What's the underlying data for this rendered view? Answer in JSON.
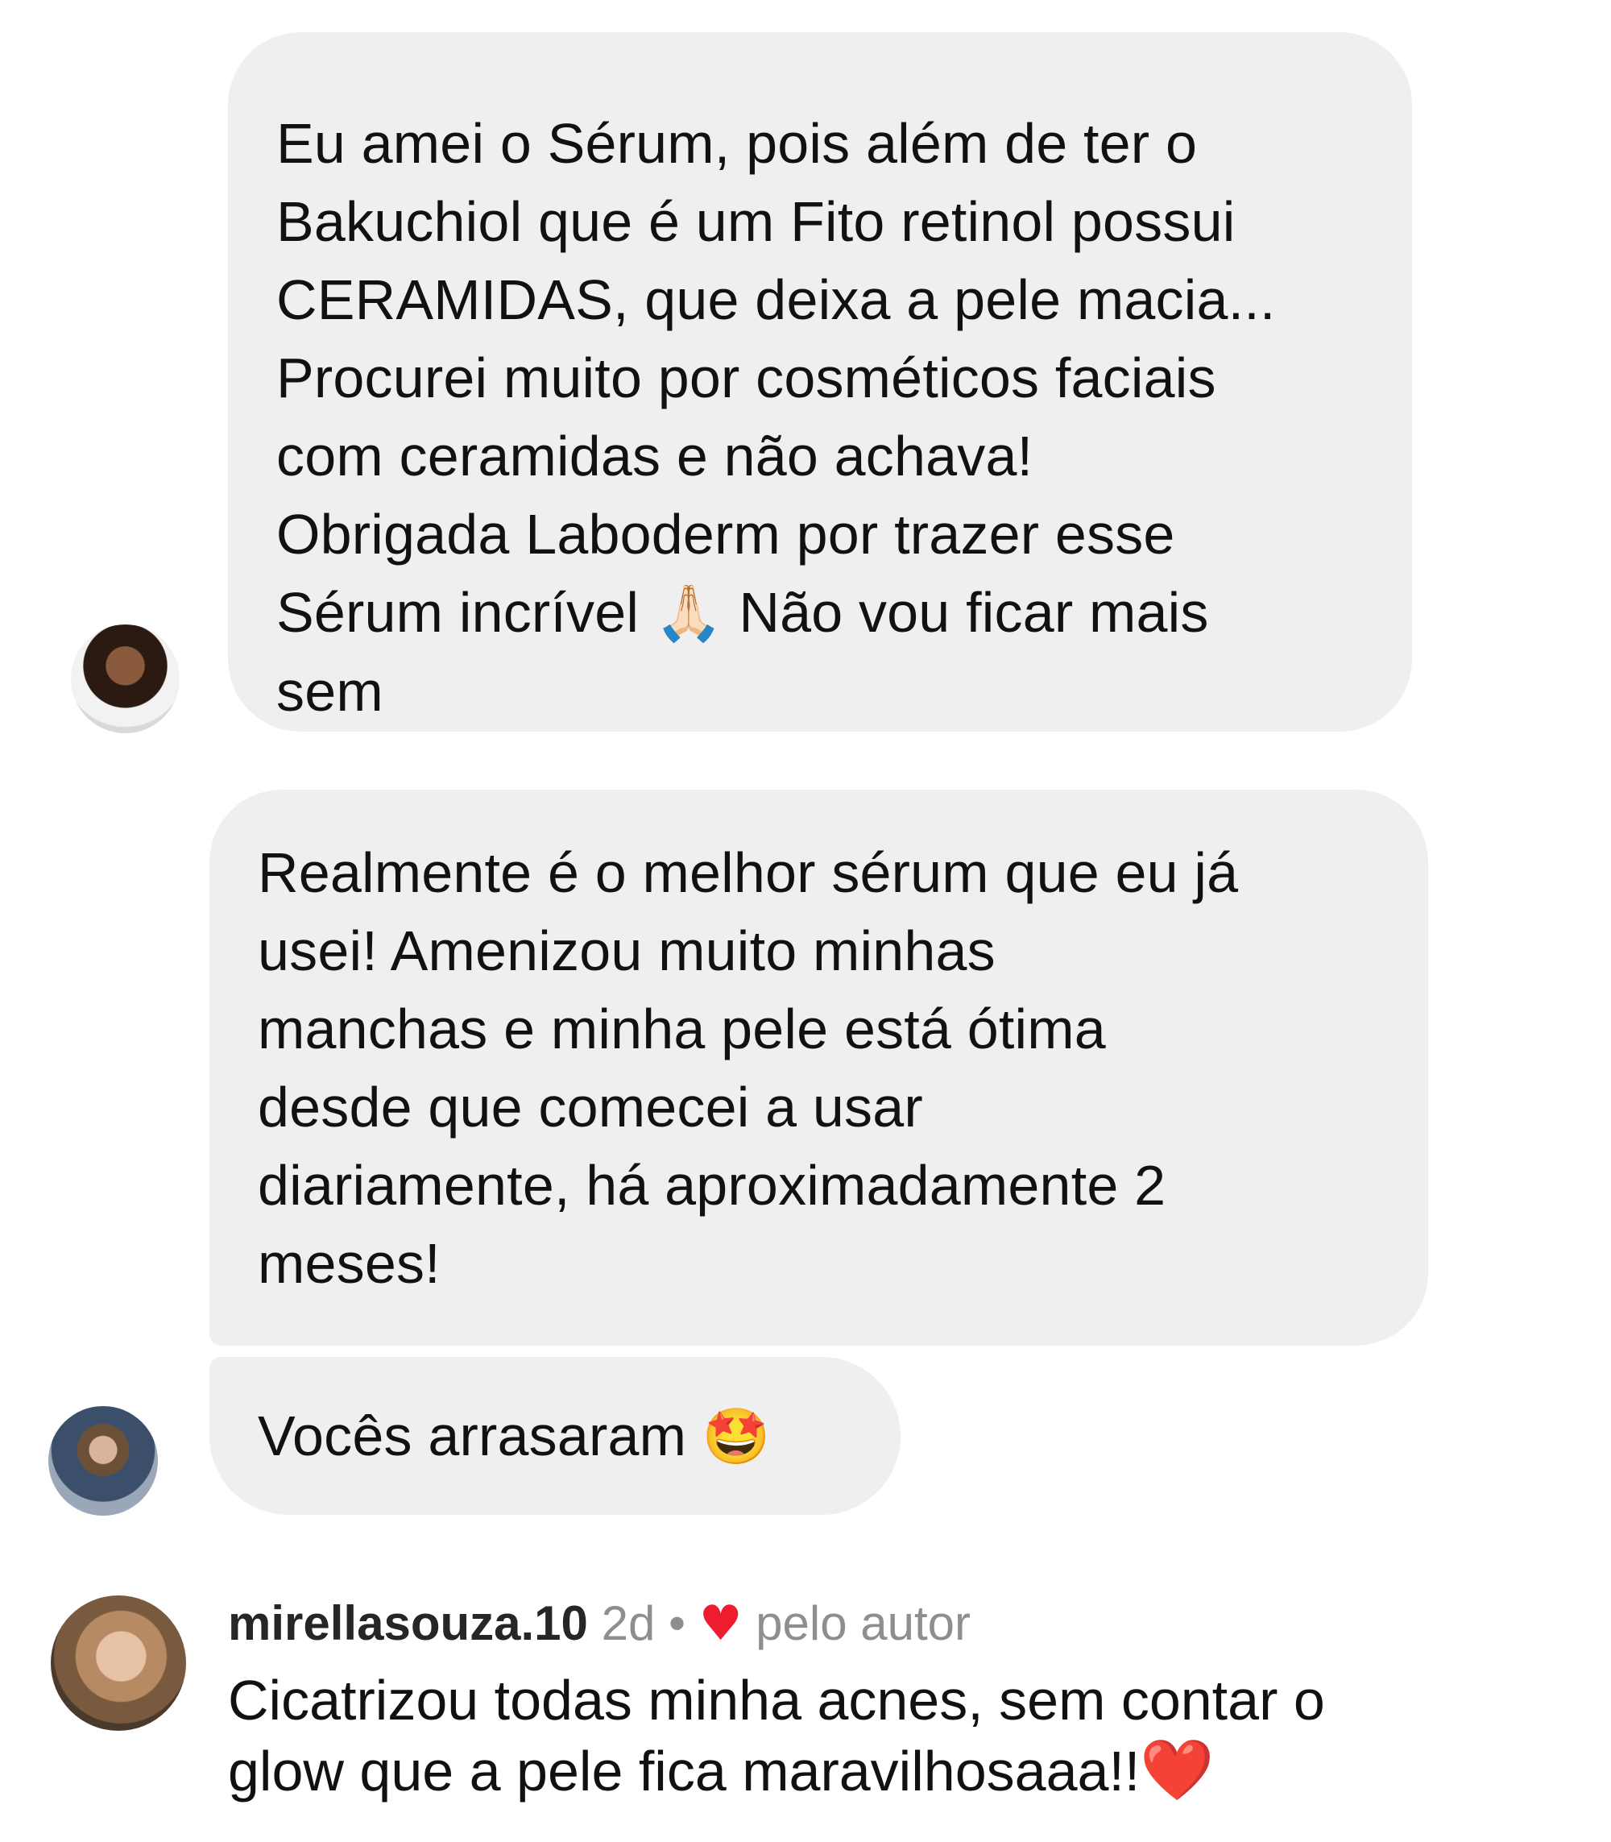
{
  "messages": [
    {
      "lines_before_emoji": "Eu amei o Sérum, pois além de ter o\nBakuchiol que é um Fito retinol possui\nCERAMIDAS, que deixa a pele macia...\nProcurei muito por cosméticos faciais\ncom ceramidas e não achava!\nObrigada Laboderm por trazer esse\nSérum incrível ",
      "emoji": "🙏🏻",
      "lines_after_emoji": " Não vou ficar mais\nsem"
    },
    {
      "text": "Realmente é o melhor sérum que eu já\nusei! Amenizou muito minhas\nmanchas e minha pele está ótima\ndesde que comecei a usar\ndiariamente, há aproximadamente 2\nmeses!"
    },
    {
      "text": "Vocês arrasaram ",
      "emoji": "🤩"
    }
  ],
  "comment": {
    "username": "mirellasouza.10",
    "time": "2d",
    "separator": "•",
    "liked_by": "pelo autor",
    "heart_icon": "heart-icon",
    "text": "Cicatrizou todas minha acnes, sem contar o\nglow que a pele fica maravilhosaaa!!",
    "emoji": "❤️"
  },
  "colors": {
    "bubble": "#efefef",
    "heart": "#ed1c2e",
    "meta": "#8e8e8e"
  }
}
